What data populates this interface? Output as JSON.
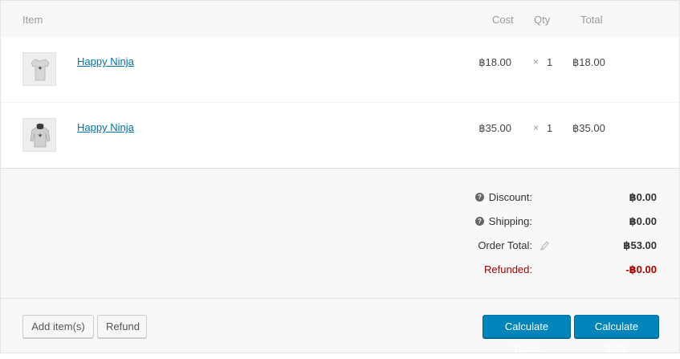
{
  "table": {
    "headers": {
      "item": "Item",
      "cost": "Cost",
      "qty": "Qty",
      "total": "Total"
    },
    "rows": [
      {
        "name": "Happy Ninja",
        "thumbnail_icon": "tshirt-icon",
        "cost": "฿18.00",
        "qty_sep": "×",
        "qty": "1",
        "total": "฿18.00"
      },
      {
        "name": "Happy Ninja",
        "thumbnail_icon": "hoodie-icon",
        "cost": "฿35.00",
        "qty_sep": "×",
        "qty": "1",
        "total": "฿35.00"
      }
    ]
  },
  "totals": {
    "discount_label": "Discount:",
    "discount_value": "฿0.00",
    "shipping_label": "Shipping:",
    "shipping_value": "฿0.00",
    "order_total_label": "Order Total:",
    "order_total_value": "฿53.00",
    "refunded_label": "Refunded:",
    "refunded_value": "-฿0.00",
    "help_glyph": "?"
  },
  "actions": {
    "add_items": "Add item(s)",
    "refund": "Refund",
    "calculate_taxes": "Calculate Taxes",
    "calculate_total": "Calculate Total"
  },
  "colors": {
    "link": "#0073aa",
    "primary_button": "#0085ba",
    "refunded": "#aa0000"
  }
}
